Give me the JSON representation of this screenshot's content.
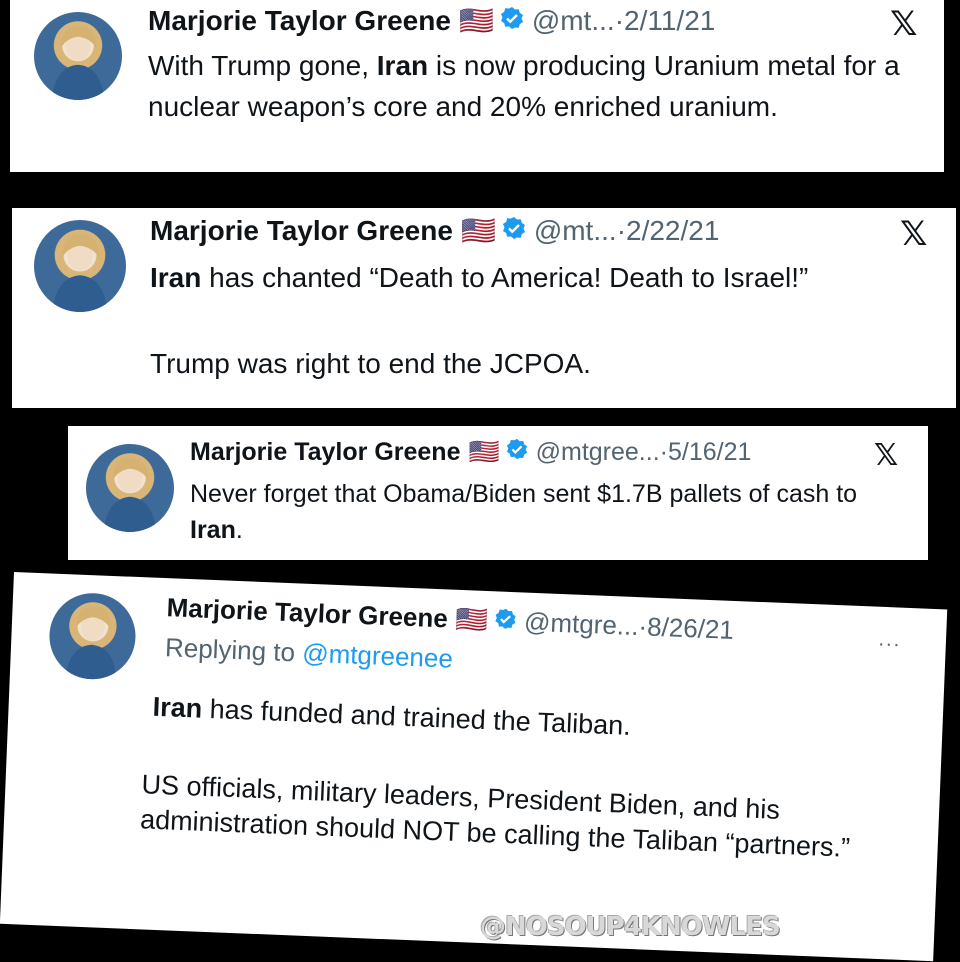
{
  "tweets": [
    {
      "name": "Marjorie Taylor Greene",
      "handle": "@mt...",
      "date": "·2/11/21",
      "text_plain1": "With Trump gone, ",
      "text_bold1": "Iran",
      "text_plain2": " is now producing Uranium metal for a nuclear weapon’s core and 20% enriched uranium.",
      "platform_icon": "x-logo-icon"
    },
    {
      "name": "Marjorie Taylor Greene",
      "handle": "@mt...",
      "date": "·2/22/21",
      "text_bold1": "Iran",
      "text_plain1": " has chanted “Death to America! Death to Israel!”",
      "text_plain2": "Trump was right to end the JCPOA.",
      "platform_icon": "x-logo-icon"
    },
    {
      "name": "Marjorie Taylor Greene",
      "handle": "@mtgree...",
      "date": "·5/16/21",
      "text_plain1": "Never forget that Obama/Biden sent $1.7B pallets of cash to ",
      "text_bold1": "Iran",
      "text_plain2": ".",
      "platform_icon": "x-logo-icon"
    },
    {
      "name": "Marjorie Taylor Greene",
      "handle": "@mtgre...",
      "date": "·8/26/21",
      "reply_prefix": "Replying to ",
      "reply_to": "@mtgreenee",
      "text_bold1": "Iran",
      "text_plain1": " has funded and trained the Taliban.",
      "text_plain2": "US officials, military leaders, President Biden, and his administration should NOT be calling the Taliban “partners.”",
      "more": "···"
    }
  ],
  "x_logo": "𝕏",
  "flag": "🇺🇸",
  "watermark": "@NOSOUP4KNOWLES",
  "colors": {
    "verified": "#1d9bf0",
    "meta": "#536471",
    "background": "#000000"
  }
}
